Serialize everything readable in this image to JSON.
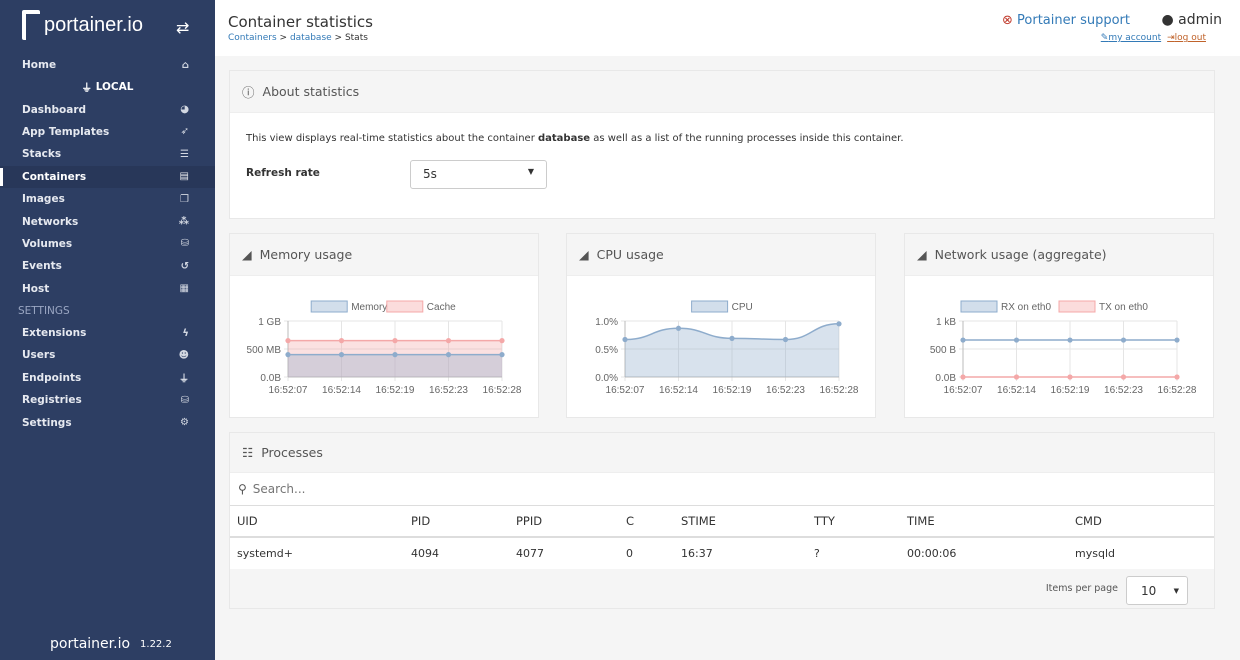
{
  "sidebar": {
    "brand": "portainer.io",
    "home": "Home",
    "endpoint": "LOCAL",
    "items": [
      {
        "label": "Dashboard",
        "icon": "tachometer-icon",
        "g": "◕"
      },
      {
        "label": "App Templates",
        "icon": "rocket-icon",
        "g": "➶"
      },
      {
        "label": "Stacks",
        "icon": "th-list-icon",
        "g": "☰"
      },
      {
        "label": "Containers",
        "icon": "server-icon",
        "g": "▤",
        "active": true
      },
      {
        "label": "Images",
        "icon": "clone-icon",
        "g": "❐"
      },
      {
        "label": "Networks",
        "icon": "sitemap-icon",
        "g": "⁂"
      },
      {
        "label": "Volumes",
        "icon": "cubes-icon",
        "g": "⛁"
      },
      {
        "label": "Events",
        "icon": "history-icon",
        "g": "↺"
      },
      {
        "label": "Host",
        "icon": "th-icon",
        "g": "▦"
      }
    ],
    "settings_title": "SETTINGS",
    "settings": [
      {
        "label": "Extensions",
        "icon": "bolt-icon",
        "g": "ϟ"
      },
      {
        "label": "Users",
        "icon": "users-icon",
        "g": "☻"
      },
      {
        "label": "Endpoints",
        "icon": "plug-icon",
        "g": "⏚"
      },
      {
        "label": "Registries",
        "icon": "database-icon",
        "g": "⛁"
      },
      {
        "label": "Settings",
        "icon": "cogs-icon",
        "g": "⚙"
      }
    ],
    "version": "1.22.2"
  },
  "header": {
    "title": "Container statistics",
    "crumbs": [
      "Containers",
      "database",
      "Stats"
    ],
    "support": "Portainer support",
    "user": "admin",
    "my_account": "my account",
    "log_out": "log out"
  },
  "about": {
    "title": "About statistics",
    "desc_pre": "This view displays real-time statistics about the container ",
    "desc_name": "database",
    "desc_post": " as well as a list of the running processes inside this container.",
    "refresh_label": "Refresh rate",
    "refresh_value": "5s"
  },
  "chart_data": [
    {
      "type": "area",
      "title": "Memory usage",
      "x": [
        "16:52:07",
        "16:52:14",
        "16:52:19",
        "16:52:23",
        "16:52:28"
      ],
      "yticks": [
        "0.0B",
        "500 MB",
        "1 GB"
      ],
      "ylim": [
        0,
        1000
      ],
      "unit": "MB",
      "series": [
        {
          "name": "Memory",
          "values": [
            400,
            400,
            400,
            400,
            400
          ],
          "color": "#8eaccc"
        },
        {
          "name": "Cache",
          "values": [
            650,
            650,
            650,
            650,
            650
          ],
          "color": "#f4a8a8"
        }
      ]
    },
    {
      "type": "area",
      "title": "CPU usage",
      "x": [
        "16:52:07",
        "16:52:14",
        "16:52:19",
        "16:52:23",
        "16:52:28"
      ],
      "yticks": [
        "0.0%",
        "0.5%",
        "1.0%"
      ],
      "ylim": [
        0,
        1
      ],
      "unit": "%",
      "series": [
        {
          "name": "CPU",
          "values": [
            0.67,
            0.87,
            0.69,
            0.67,
            0.95
          ],
          "color": "#8eaccc"
        }
      ]
    },
    {
      "type": "line",
      "title": "Network usage (aggregate)",
      "x": [
        "16:52:07",
        "16:52:14",
        "16:52:19",
        "16:52:23",
        "16:52:28"
      ],
      "yticks": [
        "0.0B",
        "500 B",
        "1 kB"
      ],
      "ylim": [
        0,
        1000
      ],
      "unit": "B",
      "series": [
        {
          "name": "RX on eth0",
          "values": [
            660,
            660,
            660,
            660,
            660
          ],
          "color": "#8eaccc"
        },
        {
          "name": "TX on eth0",
          "values": [
            0,
            0,
            0,
            0,
            0
          ],
          "color": "#f4a8a8"
        }
      ]
    }
  ],
  "processes": {
    "title": "Processes",
    "search_placeholder": "Search...",
    "columns": [
      "UID",
      "PID",
      "PPID",
      "C",
      "STIME",
      "TTY",
      "TIME",
      "CMD"
    ],
    "rows": [
      [
        "systemd+",
        "4094",
        "4077",
        "0",
        "16:37",
        "?",
        "00:00:06",
        "mysqld"
      ]
    ],
    "items_per_page_label": "Items per page",
    "items_per_page": "10"
  }
}
